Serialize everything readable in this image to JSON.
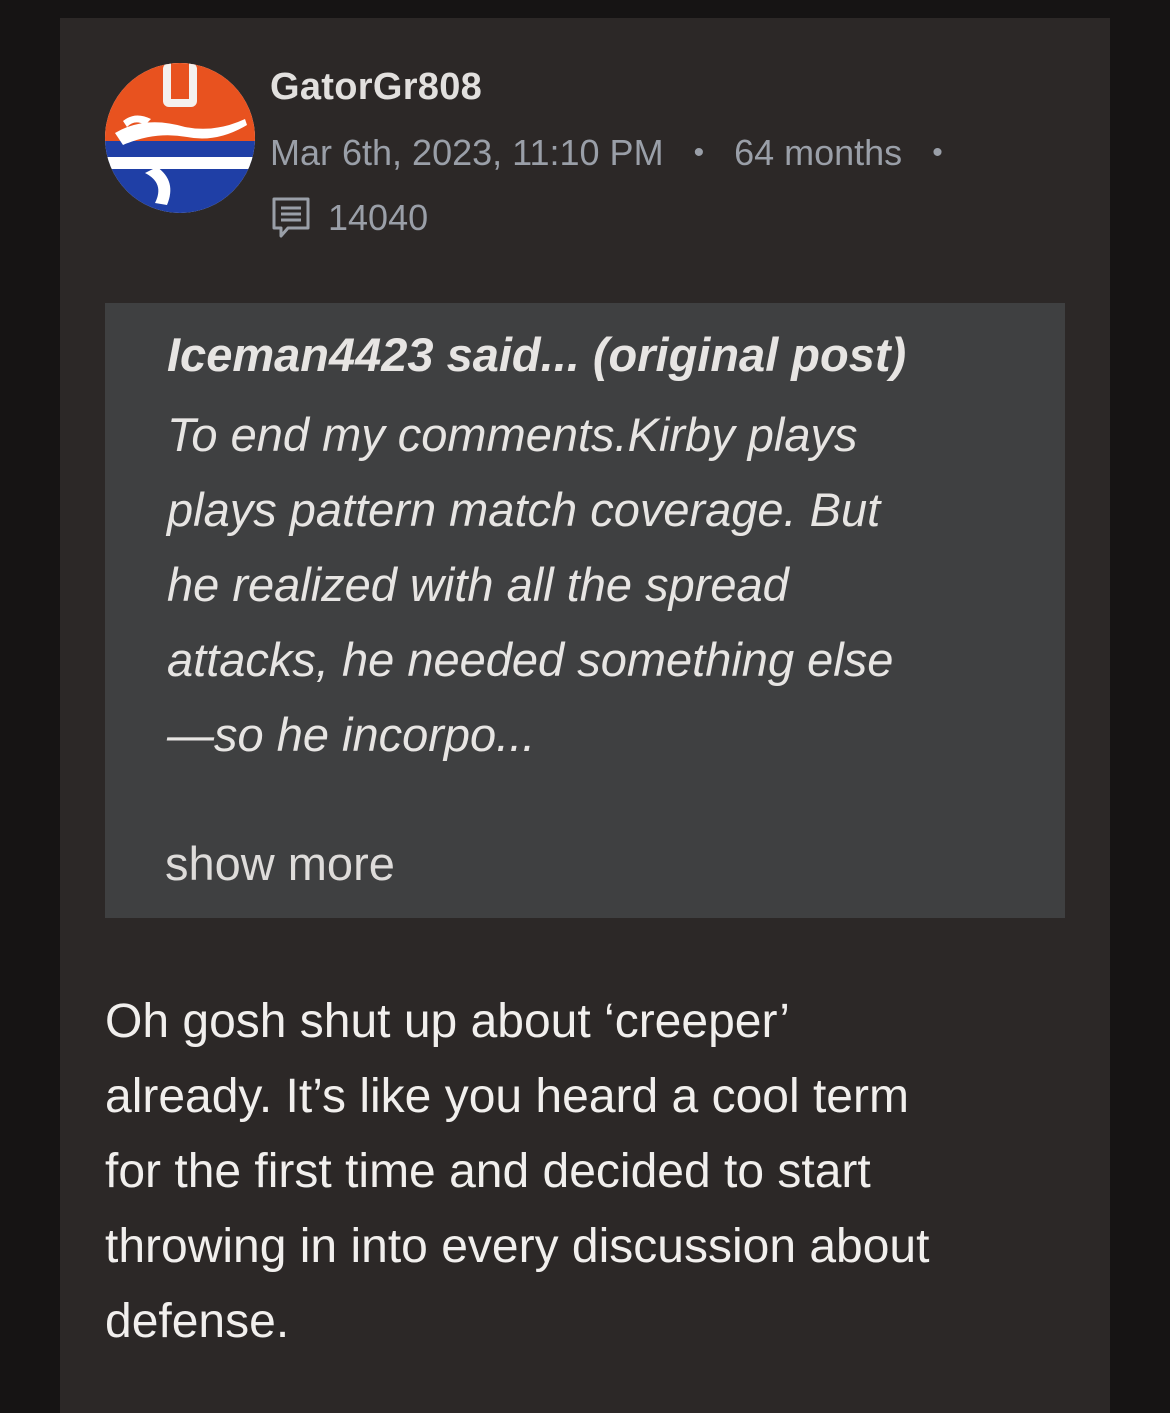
{
  "post": {
    "username": "GatorGr808",
    "timestamp": "Mar 6th, 2023, 11:10 PM",
    "separator": "•",
    "tenure": "64 months",
    "post_count": "14040",
    "avatar_icon": "florida-gators-logo-icon",
    "colors": {
      "card_bg": "#2c2827",
      "quote_bg": "#3f4041",
      "meta_text": "#9a9fa8",
      "avatar_orange": "#e8521f",
      "avatar_blue": "#1f3fa6"
    }
  },
  "quote": {
    "title": "Iceman4423 said... (original post)",
    "lines": [
      "To end my comments.Kirby plays",
      "plays pattern match coverage. But",
      "he realized with all the spread",
      "attacks, he needed something else",
      "—so he incorpo..."
    ],
    "show_more": "show more"
  },
  "body": {
    "lines": [
      "Oh gosh shut up about ‘creeper’",
      "already. It’s like you heard a cool term",
      "for the first time and decided to start",
      "throwing in into every discussion about",
      "defense."
    ]
  }
}
